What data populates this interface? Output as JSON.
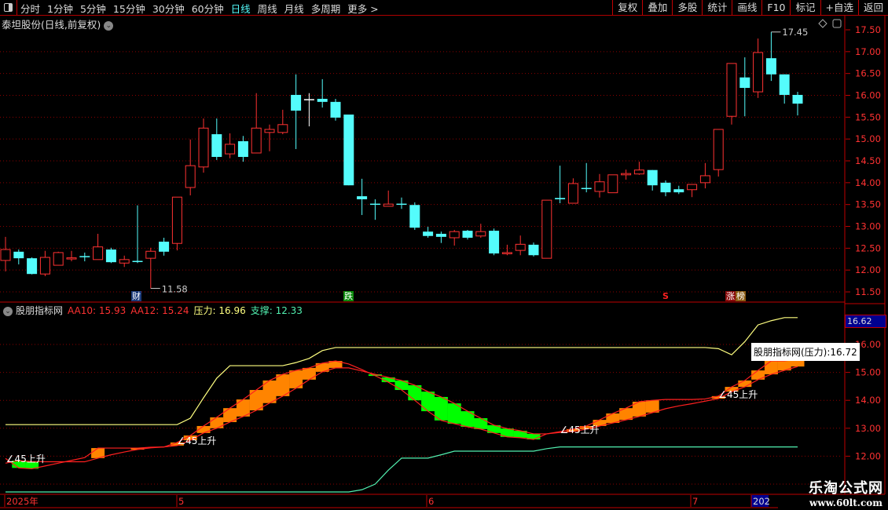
{
  "toolbar": {
    "tabs": [
      "分时",
      "1分钟",
      "5分钟",
      "15分钟",
      "30分钟",
      "60分钟",
      "日线",
      "周线",
      "月线",
      "多周期",
      "更多 >"
    ],
    "active_tab": "日线",
    "right_buttons": [
      "复权",
      "叠加",
      "多股",
      "统计",
      "画线",
      "F10",
      "标记",
      "+自选",
      "返回"
    ]
  },
  "main": {
    "title": "泰坦股份(日线,前复权)",
    "high_label": "17.45",
    "low_label": "11.58",
    "price_ticks": [
      "17.50",
      "17.00",
      "16.50",
      "16.00",
      "15.50",
      "15.00",
      "14.50",
      "14.00",
      "13.50",
      "13.00",
      "12.50",
      "12.00",
      "11.50"
    ],
    "markers": [
      {
        "text": "财",
        "color": "#1a3a7a"
      },
      {
        "text": "跌",
        "color": "#0a8a0a"
      },
      {
        "text": "S",
        "color": "#000000"
      },
      {
        "text": "涨",
        "color": "#8a0a0a"
      },
      {
        "text": "榜",
        "color": "#8a5a10"
      }
    ]
  },
  "indicator": {
    "name": "股朋指标网",
    "aa10": "AA10: 15.93",
    "aa12": "AA12: 15.24",
    "pressure_label": "压力",
    "pressure_value": ": 16.96",
    "support_label": "支撑",
    "support_value": ": 12.33",
    "ticks": [
      "16.00",
      "15.00",
      "14.00",
      "13.00",
      "12.00"
    ],
    "current_badge": "16.62",
    "tooltip": "股朋指标网(压力):16.72",
    "signal_label": "∠45上升"
  },
  "date_axis": {
    "labels": [
      "2025年",
      "5",
      "6",
      "7",
      "202"
    ]
  },
  "watermark": {
    "line1": "乐淘公式网",
    "line2": "www.60lt.com"
  },
  "colors": {
    "up": "#ff3232",
    "down": "#54fcfc",
    "flat": "#ffffff",
    "pressure": "#ffff80",
    "support": "#52f0b0",
    "band_up": "#ff8400",
    "band_down": "#00ff00",
    "grid": "#8b0000"
  },
  "chart_data": [
    {
      "type": "candlestick",
      "fields": [
        "open",
        "high",
        "low",
        "close"
      ],
      "ylim": [
        11.5,
        17.5
      ],
      "candles": [
        [
          12.22,
          12.76,
          11.97,
          12.47
        ],
        [
          12.42,
          12.47,
          12.13,
          12.27
        ],
        [
          12.27,
          12.29,
          11.9,
          11.91
        ],
        [
          11.91,
          12.44,
          11.86,
          12.29
        ],
        [
          12.11,
          12.42,
          12.11,
          12.4
        ],
        [
          12.26,
          12.44,
          12.2,
          12.28
        ],
        [
          12.32,
          12.4,
          12.2,
          12.3
        ],
        [
          12.24,
          12.83,
          12.24,
          12.53
        ],
        [
          12.47,
          12.51,
          12.16,
          12.18
        ],
        [
          12.16,
          12.33,
          12.07,
          12.24
        ],
        [
          12.21,
          13.48,
          12.16,
          12.2
        ],
        [
          12.27,
          12.51,
          11.58,
          12.43
        ],
        [
          12.65,
          12.74,
          12.33,
          12.42
        ],
        [
          12.61,
          13.67,
          12.45,
          13.67
        ],
        [
          13.89,
          14.99,
          13.71,
          14.39
        ],
        [
          14.36,
          15.47,
          14.23,
          15.25
        ],
        [
          15.11,
          15.47,
          14.52,
          14.59
        ],
        [
          14.66,
          15.13,
          14.56,
          14.88
        ],
        [
          14.95,
          15.07,
          14.48,
          14.59
        ],
        [
          14.68,
          16.05,
          14.68,
          15.25
        ],
        [
          15.15,
          15.33,
          14.72,
          15.22
        ],
        [
          15.15,
          15.67,
          15.11,
          15.33
        ],
        [
          16.01,
          16.48,
          14.77,
          15.65
        ],
        [
          15.9,
          16.05,
          15.29,
          15.9
        ],
        [
          15.92,
          16.37,
          15.72,
          15.85
        ],
        [
          15.85,
          15.92,
          15.42,
          15.49
        ],
        [
          15.56,
          15.56,
          13.94,
          13.94
        ],
        [
          13.69,
          14.09,
          13.26,
          13.62
        ],
        [
          13.52,
          13.62,
          13.15,
          13.51
        ],
        [
          13.46,
          13.82,
          13.46,
          13.51
        ],
        [
          13.52,
          13.66,
          13.4,
          13.51
        ],
        [
          13.49,
          13.55,
          12.92,
          12.97
        ],
        [
          12.88,
          12.99,
          12.74,
          12.78
        ],
        [
          12.83,
          12.88,
          12.62,
          12.76
        ],
        [
          12.74,
          12.92,
          12.56,
          12.88
        ],
        [
          12.9,
          12.92,
          12.7,
          12.74
        ],
        [
          12.78,
          13.06,
          12.74,
          12.88
        ],
        [
          12.9,
          12.95,
          12.34,
          12.38
        ],
        [
          12.38,
          12.58,
          12.34,
          12.4
        ],
        [
          12.45,
          12.79,
          12.34,
          12.59
        ],
        [
          12.58,
          12.63,
          12.31,
          12.34
        ],
        [
          12.27,
          13.6,
          12.27,
          13.6
        ],
        [
          13.65,
          14.39,
          13.53,
          13.62
        ],
        [
          13.53,
          14.1,
          13.53,
          13.98
        ],
        [
          13.88,
          14.45,
          13.78,
          13.86
        ],
        [
          13.8,
          14.2,
          13.66,
          14.02
        ],
        [
          13.77,
          14.18,
          13.77,
          14.18
        ],
        [
          14.18,
          14.3,
          14.07,
          14.21
        ],
        [
          14.2,
          14.48,
          14.18,
          14.29
        ],
        [
          14.29,
          14.29,
          13.82,
          13.94
        ],
        [
          14.0,
          14.05,
          13.69,
          13.78
        ],
        [
          13.85,
          13.93,
          13.74,
          13.78
        ],
        [
          13.84,
          13.96,
          13.67,
          13.96
        ],
        [
          14.0,
          14.45,
          13.87,
          14.16
        ],
        [
          14.3,
          15.22,
          14.14,
          15.22
        ],
        [
          15.52,
          16.73,
          15.33,
          16.73
        ],
        [
          16.41,
          16.87,
          15.52,
          16.17
        ],
        [
          16.08,
          17.3,
          15.94,
          16.98
        ],
        [
          16.85,
          17.45,
          16.33,
          16.48
        ],
        [
          16.48,
          16.48,
          15.81,
          16.01
        ],
        [
          16.01,
          16.08,
          15.54,
          15.81
        ]
      ]
    },
    {
      "type": "line",
      "ylim": [
        11,
        17
      ],
      "series": [
        {
          "name": "压力",
          "values": [
            13.13,
            13.13,
            13.13,
            13.13,
            13.13,
            13.13,
            13.13,
            13.13,
            13.13,
            13.13,
            13.13,
            13.13,
            13.13,
            13.13,
            13.36,
            14.09,
            14.79,
            15.24,
            15.24,
            15.24,
            15.24,
            15.24,
            15.35,
            15.5,
            15.78,
            15.89,
            15.89,
            15.89,
            15.89,
            15.89,
            15.89,
            15.89,
            15.89,
            15.89,
            15.89,
            15.89,
            15.89,
            15.89,
            15.89,
            15.89,
            15.89,
            15.89,
            15.89,
            15.89,
            15.89,
            15.89,
            15.89,
            15.89,
            15.89,
            15.89,
            15.89,
            15.89,
            15.89,
            15.89,
            15.85,
            15.63,
            16.1,
            16.7,
            16.85,
            16.96,
            16.96
          ]
        },
        {
          "name": "支撑",
          "values": [
            10.72,
            10.72,
            10.72,
            10.72,
            10.72,
            10.72,
            10.72,
            10.72,
            10.72,
            10.72,
            10.72,
            10.72,
            10.72,
            10.72,
            10.72,
            10.72,
            10.72,
            10.72,
            10.72,
            10.72,
            10.72,
            10.72,
            10.72,
            10.72,
            10.72,
            10.72,
            10.72,
            10.8,
            11.0,
            11.5,
            11.93,
            11.93,
            11.93,
            12.05,
            12.18,
            12.18,
            12.18,
            12.18,
            12.18,
            12.18,
            12.18,
            12.27,
            12.33,
            12.33,
            12.33,
            12.33,
            12.33,
            12.33,
            12.33,
            12.33,
            12.33,
            12.33,
            12.33,
            12.33,
            12.33,
            12.33,
            12.33,
            12.33,
            12.33,
            12.33,
            12.33
          ]
        },
        {
          "name": "AA10",
          "values": [
            11.92,
            11.58,
            11.55,
            11.65,
            11.75,
            11.85,
            11.95,
            12.29,
            12.29,
            12.29,
            12.29,
            12.32,
            12.33,
            12.49,
            12.74,
            13.08,
            13.39,
            13.72,
            14.03,
            14.37,
            14.71,
            14.93,
            15.07,
            15.16,
            15.33,
            15.41,
            15.3,
            15.1,
            14.88,
            14.65,
            14.37,
            14.0,
            13.61,
            13.28,
            13.16,
            13.05,
            12.97,
            12.83,
            12.69,
            12.66,
            12.6,
            12.8,
            12.88,
            12.97,
            13.08,
            13.3,
            13.53,
            13.72,
            13.95,
            14.0,
            14.03,
            14.03,
            14.03,
            14.05,
            14.15,
            14.48,
            14.71,
            15.07,
            15.41,
            15.41,
            15.47
          ]
        },
        {
          "name": "AA12",
          "values": [
            11.75,
            11.84,
            11.81,
            11.8,
            11.8,
            11.8,
            11.8,
            11.93,
            12.05,
            12.15,
            12.24,
            12.3,
            12.33,
            12.38,
            12.57,
            12.83,
            13.0,
            13.22,
            13.42,
            13.64,
            13.9,
            14.15,
            14.43,
            14.74,
            15.02,
            15.16,
            15.16,
            15.05,
            14.93,
            14.82,
            14.71,
            14.54,
            14.31,
            14.12,
            13.89,
            13.61,
            13.36,
            13.11,
            12.99,
            12.91,
            12.8,
            12.8,
            12.85,
            12.88,
            12.97,
            13.08,
            13.19,
            13.3,
            13.42,
            13.56,
            13.7,
            13.8,
            13.88,
            13.97,
            14.06,
            14.31,
            14.48,
            14.74,
            14.93,
            15.07,
            15.21
          ]
        }
      ],
      "band_bars": [
        1,
        2,
        7,
        10,
        13,
        14,
        15,
        16,
        17,
        18,
        19,
        20,
        21,
        22,
        23,
        24,
        25,
        28,
        29,
        30,
        31,
        32,
        33,
        34,
        35,
        36,
        37,
        38,
        39,
        40,
        43,
        44,
        45,
        46,
        47,
        48,
        49,
        54,
        55,
        56,
        57,
        58,
        59,
        60
      ],
      "signals": [
        1,
        13,
        42,
        54
      ]
    }
  ]
}
